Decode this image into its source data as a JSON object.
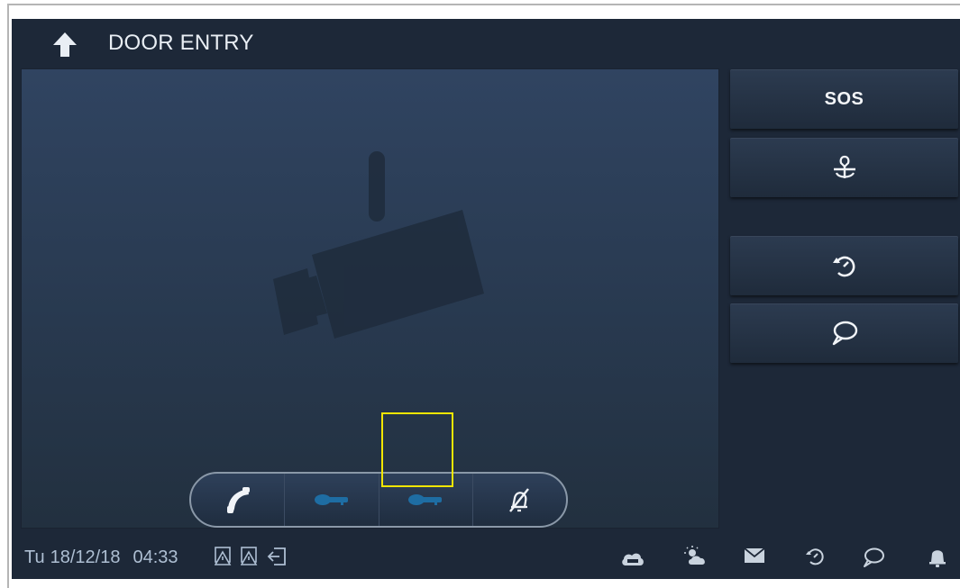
{
  "header": {
    "title": "DOOR ENTRY",
    "back_icon": "up-arrow-icon"
  },
  "video": {
    "placeholder_icon": "cctv-camera-icon"
  },
  "controls": [
    {
      "name": "answer-call-button",
      "icon": "phone-handset-icon",
      "enabled": true
    },
    {
      "name": "unlock-1-button",
      "icon": "key-icon",
      "enabled": false
    },
    {
      "name": "unlock-2-button",
      "icon": "key-icon",
      "enabled": false,
      "highlighted": true
    },
    {
      "name": "mute-button",
      "icon": "bell-muted-icon",
      "enabled": true
    }
  ],
  "side_buttons": [
    {
      "label": "SOS",
      "icon": null
    },
    {
      "label": "",
      "icon": "surveillance-switch-icon"
    },
    {
      "label": "",
      "icon": "history-icon"
    },
    {
      "label": "",
      "icon": "message-icon"
    }
  ],
  "status": {
    "day": "Tu",
    "date": "18/12/18",
    "time": "04:33",
    "left_icons": [
      "alarm-zone-1-icon",
      "alarm-zone-2-icon",
      "exit-icon"
    ],
    "right_icons": [
      "cloud-pm25-icon",
      "weather-icon",
      "mail-icon",
      "history-icon",
      "message-icon",
      "bell-icon"
    ]
  },
  "colors": {
    "background": "#1d2838",
    "highlight": "#f2e600",
    "disabled_icon": "#1e6da3",
    "icon": "#e8edf3"
  }
}
